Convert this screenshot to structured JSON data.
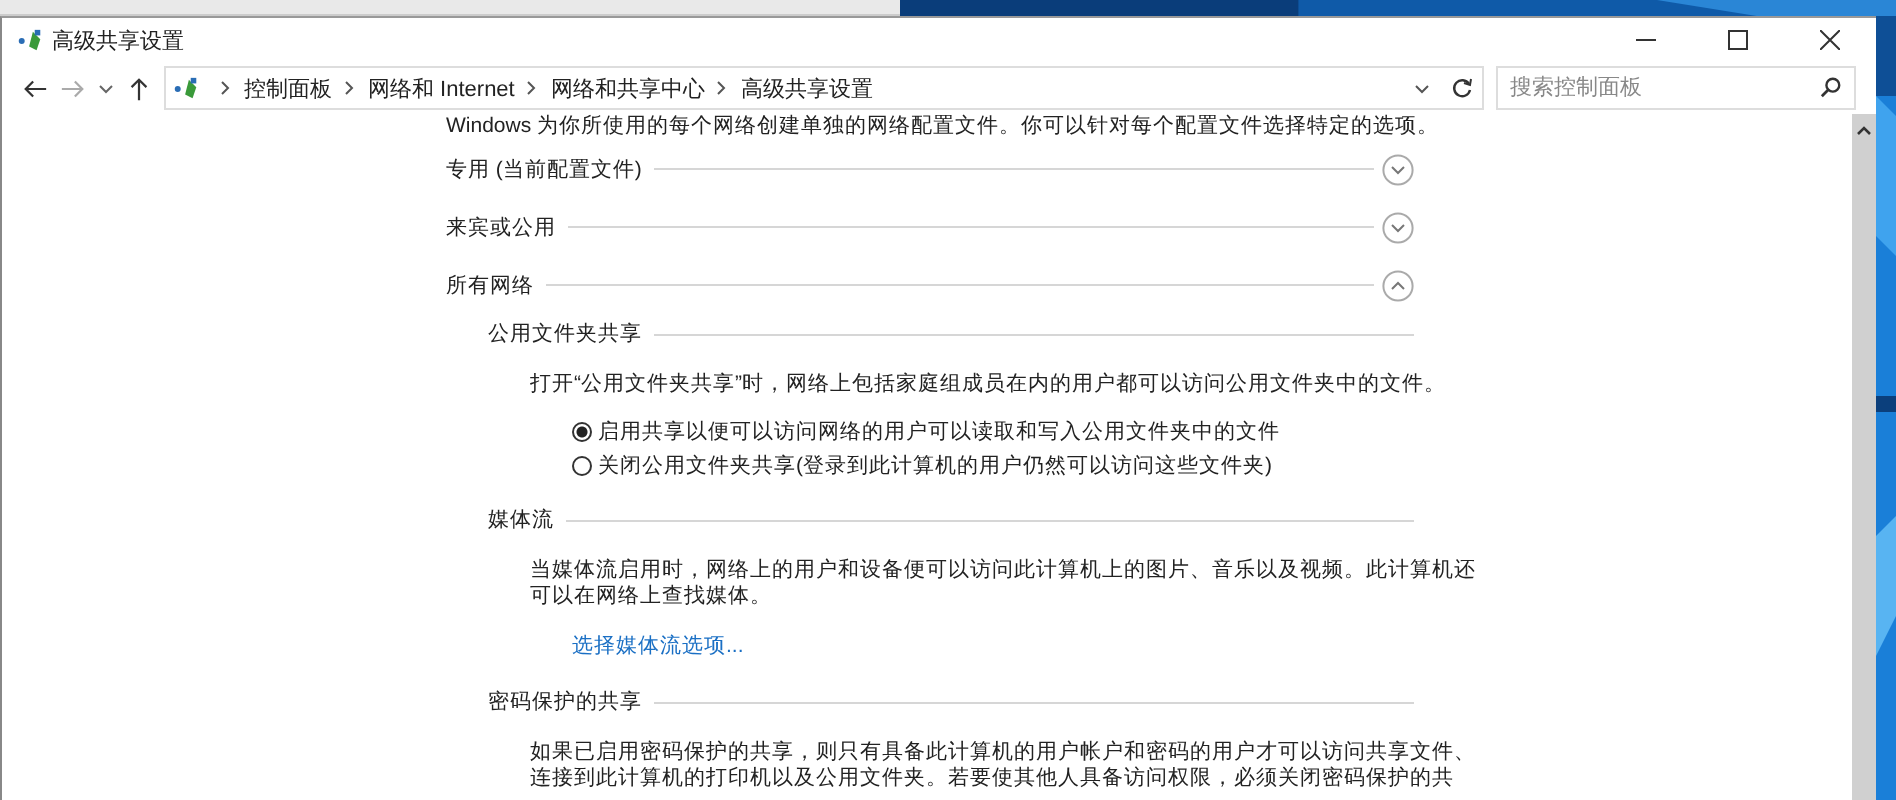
{
  "window": {
    "title": "高级共享设置"
  },
  "address_bar": {
    "breadcrumbs": [
      "控制面板",
      "网络和 Internet",
      "网络和共享中心",
      "高级共享设置"
    ]
  },
  "search": {
    "placeholder": "搜索控制面板"
  },
  "intro": "Windows 为你所使用的每个网络创建单独的网络配置文件。你可以针对每个配置文件选择特定的选项。",
  "profiles": [
    {
      "label": "专用 (当前配置文件)",
      "expanded": false
    },
    {
      "label": "来宾或公用",
      "expanded": false
    },
    {
      "label": "所有网络",
      "expanded": true
    }
  ],
  "sections": [
    {
      "heading": "公用文件夹共享",
      "description": [
        "打开“公用文件夹共享”时，网络上包括家庭组成员在内的用户都可以访问公用文件夹中的文件。"
      ],
      "options": [
        {
          "label": "启用共享以便可以访问网络的用户可以读取和写入公用文件夹中的文件",
          "selected": true
        },
        {
          "label": "关闭公用文件夹共享(登录到此计算机的用户仍然可以访问这些文件夹)",
          "selected": false
        }
      ]
    },
    {
      "heading": "媒体流",
      "description": [
        "当媒体流启用时，网络上的用户和设备便可以访问此计算机上的图片、音乐以及视频。此计算机还",
        "可以在网络上查找媒体。"
      ],
      "link": "选择媒体流选项..."
    },
    {
      "heading": "密码保护的共享",
      "description": [
        "如果已启用密码保护的共享，则只有具备此计算机的用户帐户和密码的用户才可以访问共享文件、",
        "连接到此计算机的打印机以及公用文件夹。若要使其他人具备访问权限，必须关闭密码保护的共"
      ]
    }
  ]
}
